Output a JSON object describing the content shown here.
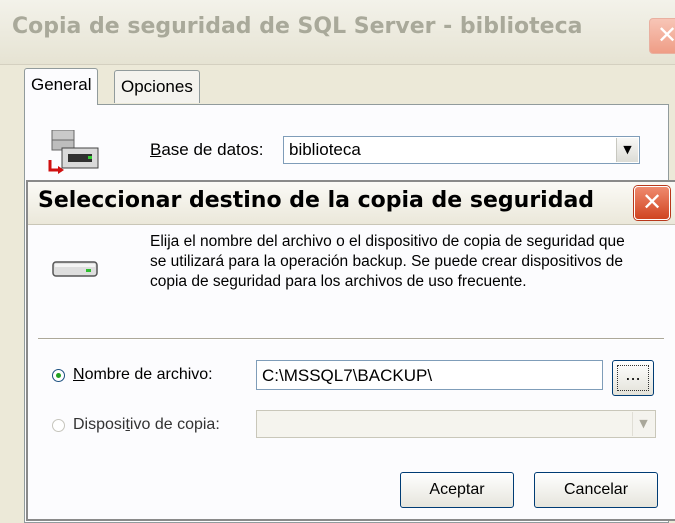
{
  "back_window": {
    "title": "Copia de seguridad de SQL Server - biblioteca",
    "close_glyph": "✕",
    "tabs": [
      "General",
      "Opciones"
    ],
    "database_label_prefix": "B",
    "database_label_rest": "ase de datos:",
    "database_value": "biblioteca",
    "dropdown_glyph": "▼"
  },
  "dialog": {
    "title": "Seleccionar destino de la copia de seguridad",
    "close_glyph": "✕",
    "description": "Elija el nombre del archivo o el dispositivo de copia de seguridad que se utilizará para la operación backup. Se puede crear dispositivos de copia de seguridad para los archivos de uso frecuente.",
    "file_option_prefix": "N",
    "file_option_rest": "ombre de archivo:",
    "file_option_checked": true,
    "file_value": "C:\\MSSQL7\\BACKUP\\",
    "browse_label": "...",
    "device_option_before": "Disposi",
    "device_option_underlined": "t",
    "device_option_after": "ivo de copia:",
    "device_option_checked": false,
    "device_value": "",
    "device_dropdown_glyph": "▼",
    "ok_label": "Aceptar",
    "cancel_label": "Cancelar"
  },
  "icons": {
    "database": "database-server-icon",
    "backup_device": "tape-drive-icon"
  },
  "colors": {
    "window_bg": "#ece9d8",
    "close_red": "#d04421",
    "active_tab_border": "#919b9c"
  }
}
